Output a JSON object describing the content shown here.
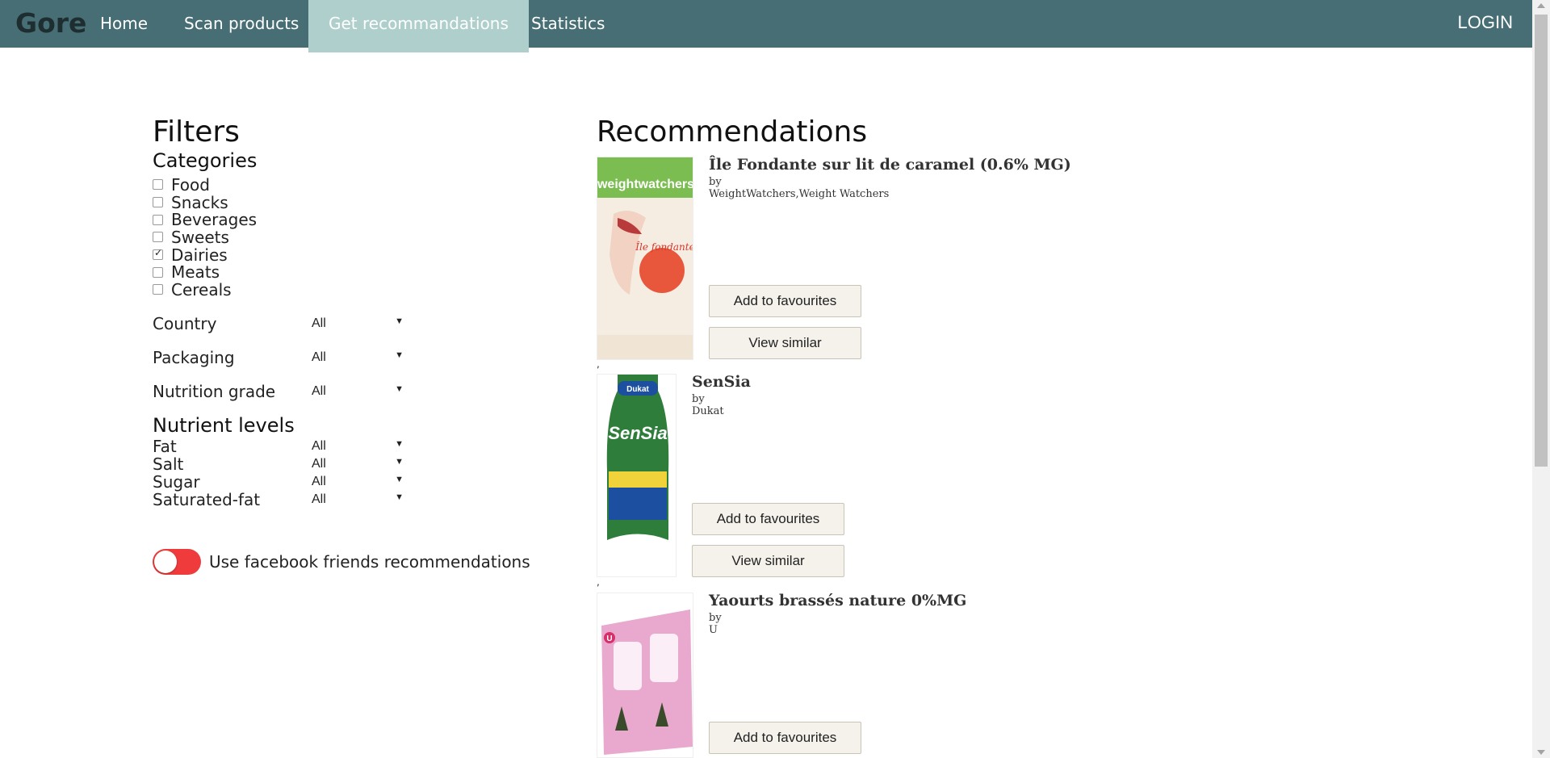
{
  "nav": {
    "brand": "Gore",
    "items": [
      "Home",
      "Scan products",
      "Get recommandations",
      "Statistics"
    ],
    "login": "LOGIN"
  },
  "filters": {
    "title": "Filters",
    "categories_title": "Categories",
    "categories": [
      {
        "label": "Food",
        "checked": false
      },
      {
        "label": "Snacks",
        "checked": false
      },
      {
        "label": "Beverages",
        "checked": false
      },
      {
        "label": "Sweets",
        "checked": false
      },
      {
        "label": "Dairies",
        "checked": true
      },
      {
        "label": "Meats",
        "checked": false
      },
      {
        "label": "Cereals",
        "checked": false
      }
    ],
    "country": {
      "label": "Country",
      "value": "All"
    },
    "packaging": {
      "label": "Packaging",
      "value": "All"
    },
    "nutrition_grade": {
      "label": "Nutrition grade",
      "value": "All"
    },
    "nutrient_levels_title": "Nutrient levels",
    "nutrients": [
      {
        "label": "Fat",
        "value": "All"
      },
      {
        "label": "Salt",
        "value": "All"
      },
      {
        "label": "Sugar",
        "value": "All"
      },
      {
        "label": "Saturated-fat",
        "value": "All"
      }
    ],
    "facebook_toggle": {
      "label": "Use facebook friends recommendations",
      "on": false,
      "color": "#ef3b3b"
    }
  },
  "recommendations": {
    "title": "Recommendations",
    "items": [
      {
        "title": "Île Fondante sur lit de caramel (0.6% MG)",
        "by": "by",
        "brand": "WeightWatchers,Weight Watchers",
        "image_text": "weightwatchers",
        "image_subtext": "Île fondante"
      },
      {
        "title": "SenSia",
        "by": "by",
        "brand": "Dukat",
        "image_text": "SenSia",
        "image_subtext": "Dukat"
      },
      {
        "title": "Yaourts brassés nature 0%MG",
        "by": "by",
        "brand": "U",
        "image_text": "U",
        "image_subtext": ""
      }
    ],
    "add_label": "Add to favourites",
    "similar_label": "View similar",
    "tick": ","
  },
  "colors": {
    "navbar": "#466e74",
    "nav_active": "#aecfcb",
    "toggle": "#ef3b3b"
  }
}
